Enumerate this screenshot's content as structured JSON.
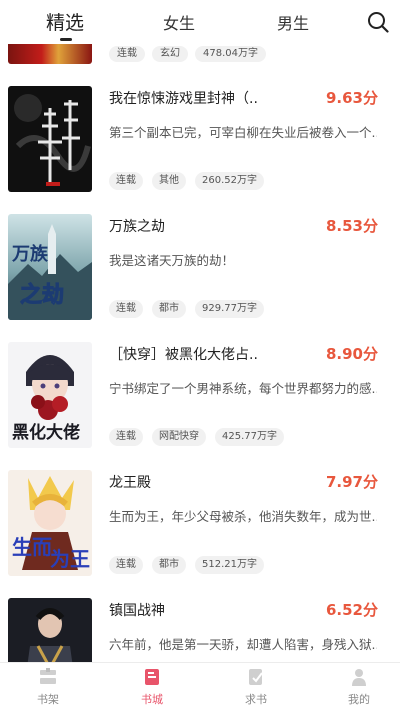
{
  "tabs": [
    {
      "label": "精选",
      "active": true
    },
    {
      "label": "女生",
      "active": false
    },
    {
      "label": "男生",
      "active": false
    }
  ],
  "partial_top": {
    "tags": [
      "连载",
      "玄幻",
      "478.04万字"
    ]
  },
  "books": [
    {
      "title": "我在惊悚游戏里封神（...",
      "score": "9.63分",
      "desc": "第三个副本已完，可宰白柳在失业后被卷入一个...",
      "tags": [
        "连载",
        "其他",
        "260.52万字"
      ],
      "cover_text": "惊悚游戏"
    },
    {
      "title": "万族之劫",
      "score": "8.53分",
      "desc": "我是这诸天万族的劫！",
      "tags": [
        "连载",
        "都市",
        "929.77万字"
      ],
      "cover_text": "万族之劫"
    },
    {
      "title": "［快穿］被黑化大佬占...",
      "score": "8.90分",
      "desc": "宁书绑定了一个男神系统，每个世界都努力的感...",
      "tags": [
        "连载",
        "网配快穿",
        "425.77万字"
      ],
      "cover_text": "黑化大佬"
    },
    {
      "title": "龙王殿",
      "score": "7.97分",
      "desc": "生而为王，年少父母被杀，他消失数年，成为世...",
      "tags": [
        "连载",
        "都市",
        "512.21万字"
      ],
      "cover_text": "生而为王"
    },
    {
      "title": "镇国战神",
      "score": "6.52分",
      "desc": "六年前，他是第一天骄，却遭人陷害，身残入狱...",
      "tags": [],
      "cover_text": ""
    }
  ],
  "nav": [
    {
      "label": "书架",
      "active": false
    },
    {
      "label": "书城",
      "active": true
    },
    {
      "label": "求书",
      "active": false
    },
    {
      "label": "我的",
      "active": false
    }
  ],
  "colors": {
    "accent": "#e8546a",
    "score": "#e8573d"
  }
}
